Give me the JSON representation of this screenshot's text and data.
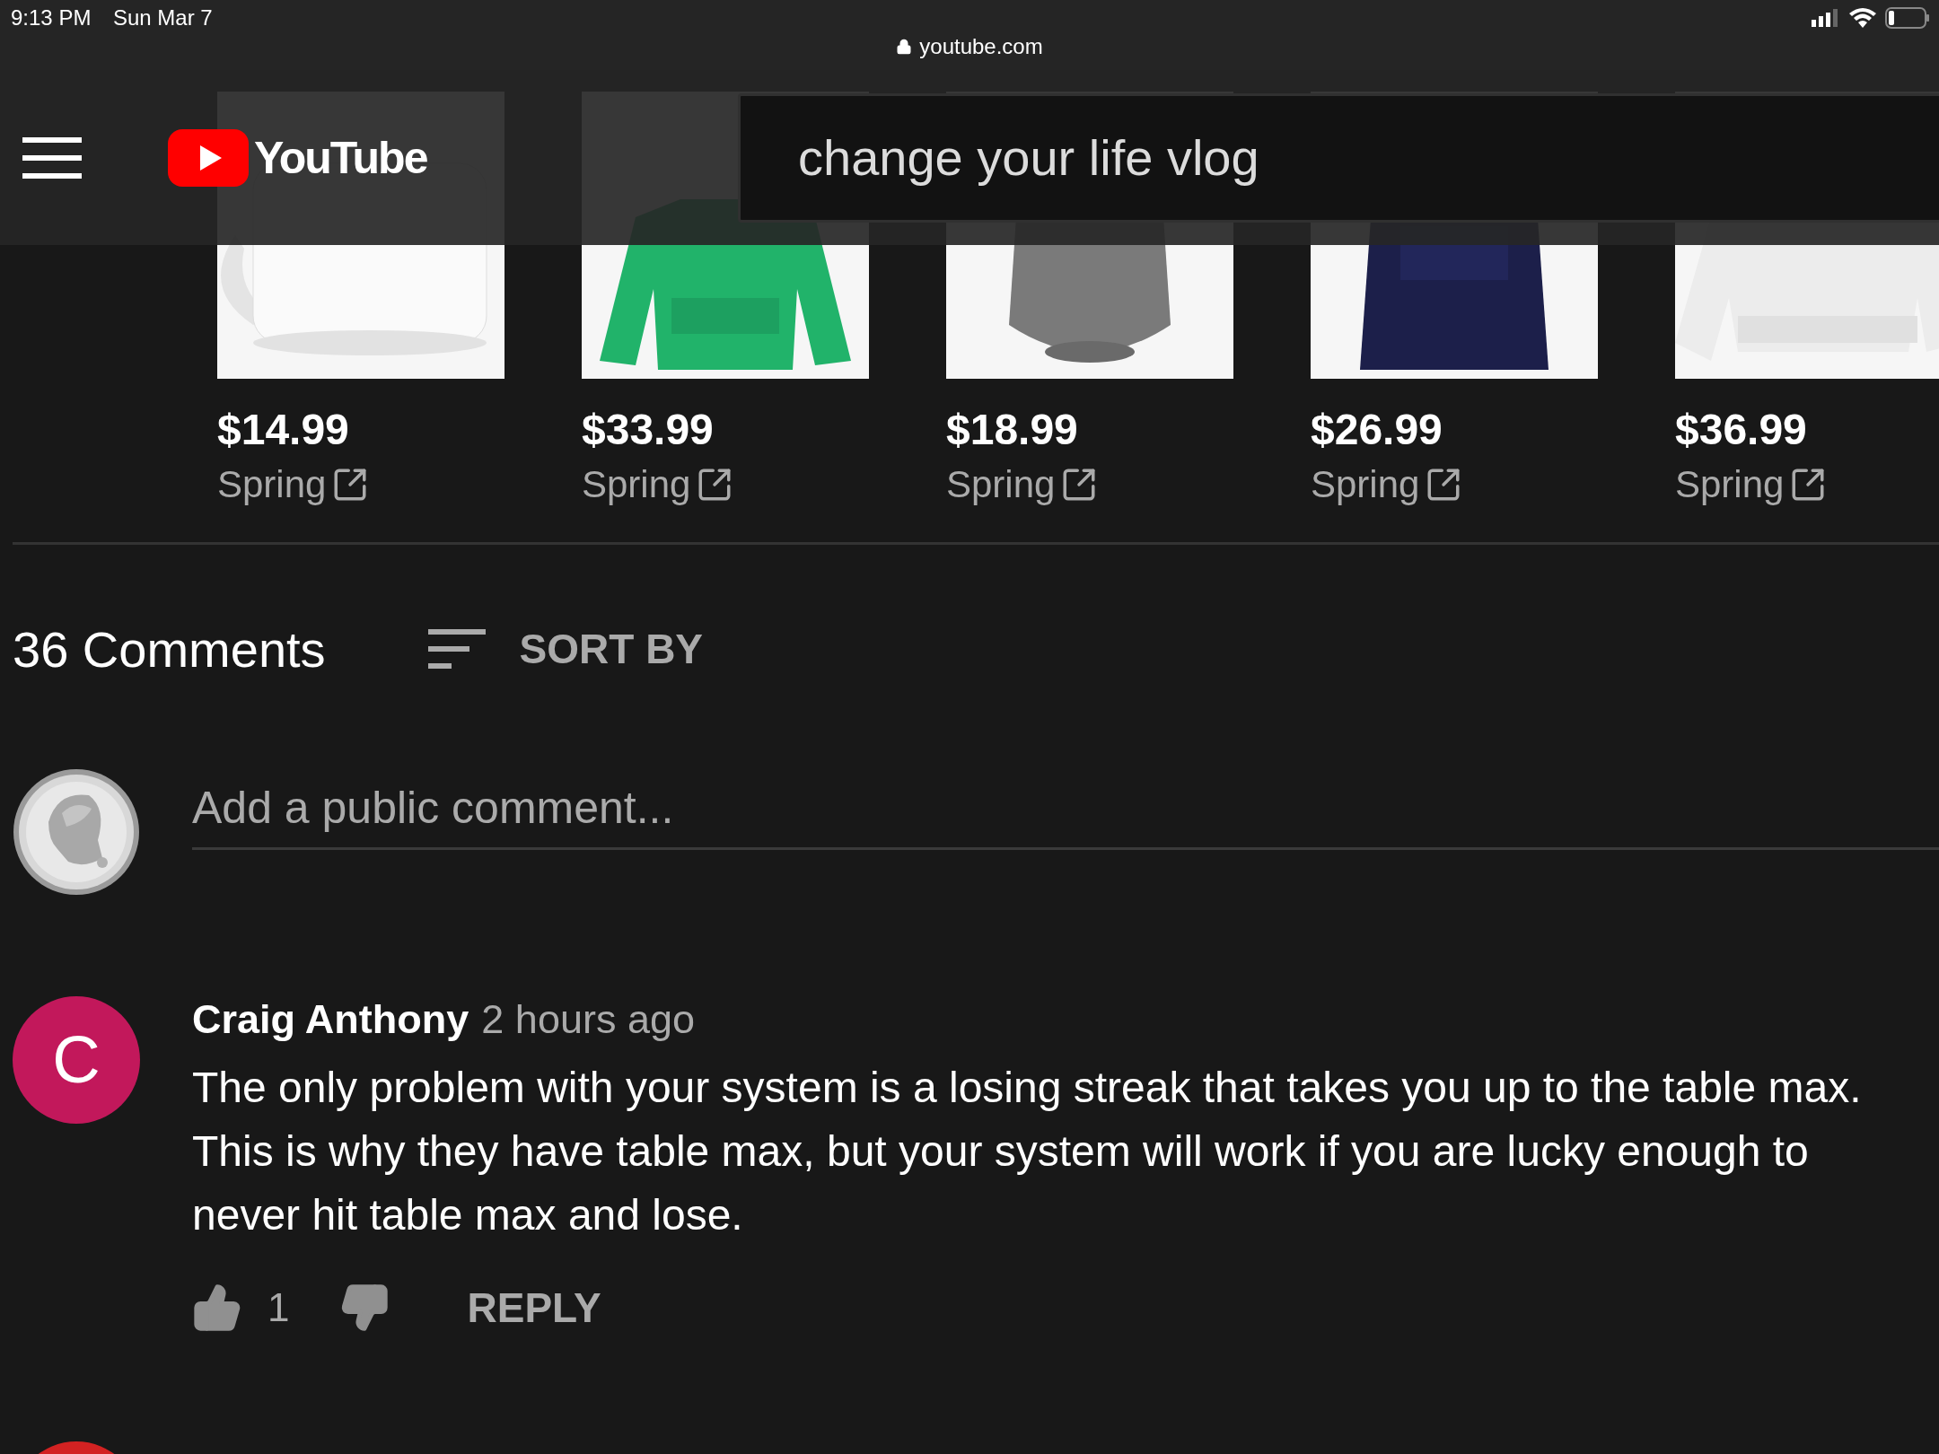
{
  "status_bar": {
    "time": "9:13 PM",
    "date": "Sun Mar 7",
    "url": "youtube.com"
  },
  "header": {
    "logo": "YouTube",
    "search_value": "change your life vlog"
  },
  "products": [
    {
      "kind": "picture",
      "price": "$14.99",
      "store": "Spring"
    },
    {
      "kind": "picture",
      "price": "$33.99",
      "store": "Spring"
    },
    {
      "kind": "picture",
      "price": "$18.99",
      "store": "Spring"
    },
    {
      "kind": "picture",
      "price": "$26.99",
      "store": "Spring"
    },
    {
      "kind": "picture",
      "price": "$36.99",
      "store": "Spring"
    }
  ],
  "comments_header": {
    "count": "36 Comments",
    "sort": "SORT BY"
  },
  "comment_box": {
    "placeholder": "Add a public comment..."
  },
  "comments": [
    {
      "avatar_letter": "C",
      "author": "Craig Anthony",
      "time": "2 hours ago",
      "text": "The only problem with your system is a losing streak that takes you up to the table max. This is why they have table max, but your system will work if you are lucky enough to never hit table max and lose.",
      "likes": "1",
      "reply": "REPLY"
    }
  ]
}
